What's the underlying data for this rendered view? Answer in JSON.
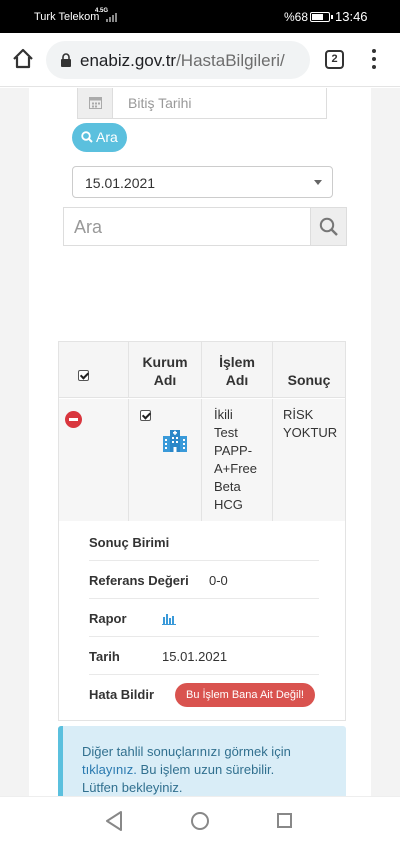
{
  "status_bar": {
    "carrier": "Turk Telekom",
    "network": "4.5G",
    "battery": "%68",
    "battery_level": 0.68,
    "time": "13:46"
  },
  "browser": {
    "url_domain": "enabiz.gov.tr",
    "url_path": "/HastaBilgileri/",
    "tab_count": "2"
  },
  "filters": {
    "end_date_placeholder": "Bitiş Tarihi",
    "search_button": "Ara",
    "date_select": "15.01.2021",
    "search_placeholder": "Ara"
  },
  "table": {
    "headers": [
      "Kurum\nAdı",
      "İşlem\nAdı",
      "Sonuç"
    ],
    "row": {
      "islem_adi": "İkili\nTest\nPAPP-\nA+Free\nBeta\nHCG",
      "sonuc": "RİSK\nYOKTUR"
    },
    "details": {
      "sonuc_birimi": "Sonuç Birimi",
      "referans_label": "Referans Değeri",
      "referans_value": "0-0",
      "rapor_label": "Rapor",
      "tarih_label": "Tarih",
      "tarih_value": "15.01.2021",
      "hata_label": "Hata Bildir",
      "hata_button": "Bu İşlem Bana Ait Değil!"
    }
  },
  "info": {
    "line1": "Diğer tahlil sonuçlarınızı görmek için",
    "link": "tıklayınız.",
    "line2": " Bu işlem uzun sürebilir.",
    "line3": "Lütfen bekleyiniz."
  },
  "colors": {
    "accent": "#5bc0de",
    "danger": "#d9534f",
    "info_bg": "#d9edf7"
  }
}
